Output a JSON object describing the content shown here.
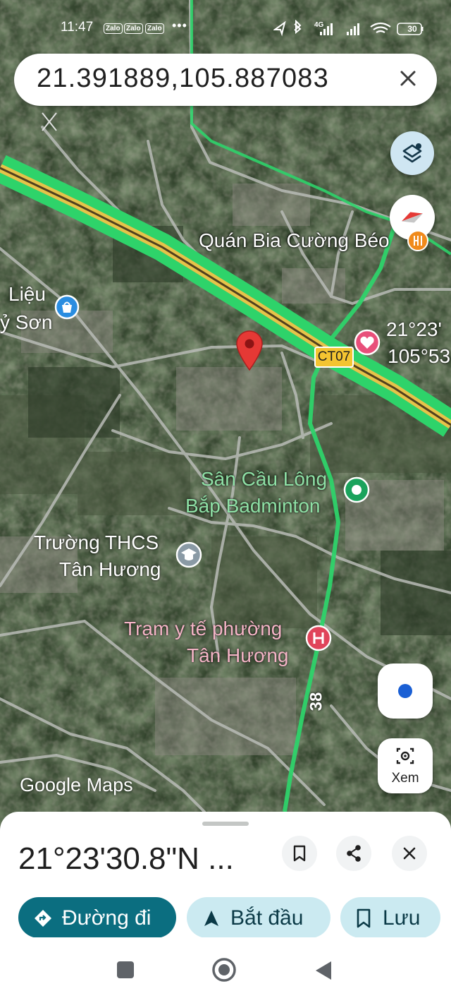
{
  "status_bar": {
    "time": "11:47",
    "notifications": [
      "Zalo",
      "Zalo",
      "Zalo"
    ],
    "more": "•••",
    "network": "4G",
    "battery": "30"
  },
  "search": {
    "query": "21.391889,105.887083"
  },
  "map": {
    "labels": {
      "quan_bia": "Quán Bia Cường Béo",
      "lieu": "Liệu",
      "son": "ỷ Sơn",
      "coord_1": "21°23'",
      "coord_2": "105°53",
      "ct07": "CT07",
      "san_cau_long_1": "Sân Cầu Lông",
      "san_cau_long_2": "Bắp Badminton",
      "truong_1": "Trường THCS",
      "truong_2": "Tân Hương",
      "tram_1": "Trạm y tế phường",
      "tram_2": "Tân Hương",
      "road_38": "38"
    },
    "logo": "Google Maps",
    "xem_label": "Xem",
    "colors": {
      "road_green": "#2ed36a",
      "highway_yellow": "#e6c34a",
      "pin_red": "#e53935",
      "label_green": "#8ee0a5",
      "label_pink": "#f4b4c6"
    }
  },
  "sheet": {
    "coordinate": "21°23'30.8\"N ...",
    "directions_label": "Đường đi",
    "start_label": "Bắt đầu",
    "save_label": "Lưu"
  }
}
